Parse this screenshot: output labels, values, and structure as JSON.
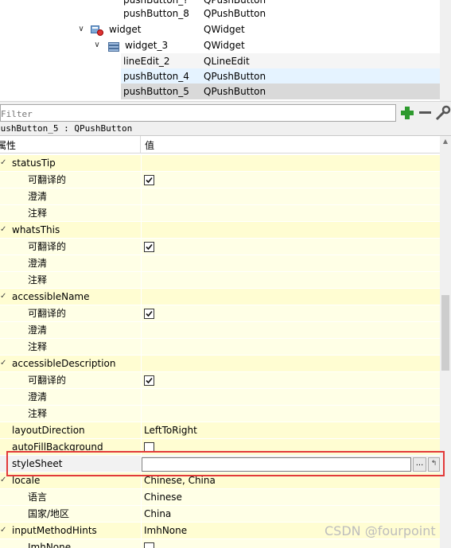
{
  "tree": {
    "rows": [
      {
        "name": "pushButton_?",
        "class": "QPushButton"
      },
      {
        "name": "pushButton_8",
        "class": "QPushButton"
      },
      {
        "name": "widget",
        "class": "QWidget"
      },
      {
        "name": "widget_3",
        "class": "QWidget"
      },
      {
        "name": "lineEdit_2",
        "class": "QLineEdit"
      },
      {
        "name": "pushButton_4",
        "class": "QPushButton"
      },
      {
        "name": "pushButton_5",
        "class": "QPushButton"
      }
    ],
    "icons": [
      "widget-form-icon",
      "layout-icon"
    ]
  },
  "filter": {
    "placeholder": "Filter"
  },
  "toolbar": {
    "icons": [
      "plus-icon",
      "minus-icon",
      "wrench-icon"
    ]
  },
  "object_title": "pushButton_5 : QPushButton",
  "grid": {
    "headers": {
      "property": "属性",
      "value": "值"
    },
    "rows": [
      {
        "name": "statusTip",
        "level": 0,
        "value": ""
      },
      {
        "name": "可翻译的",
        "level": 1,
        "checkbox": true,
        "checked": true
      },
      {
        "name": "澄清",
        "level": 1,
        "value": ""
      },
      {
        "name": "注释",
        "level": 1,
        "value": ""
      },
      {
        "name": "whatsThis",
        "level": 0,
        "value": ""
      },
      {
        "name": "可翻译的",
        "level": 1,
        "checkbox": true,
        "checked": true
      },
      {
        "name": "澄清",
        "level": 1,
        "value": ""
      },
      {
        "name": "注释",
        "level": 1,
        "value": ""
      },
      {
        "name": "accessibleName",
        "level": 0,
        "value": ""
      },
      {
        "name": "可翻译的",
        "level": 1,
        "checkbox": true,
        "checked": true
      },
      {
        "name": "澄清",
        "level": 1,
        "value": ""
      },
      {
        "name": "注释",
        "level": 1,
        "value": ""
      },
      {
        "name": "accessibleDescription",
        "level": 0,
        "value": ""
      },
      {
        "name": "可翻译的",
        "level": 1,
        "checkbox": true,
        "checked": true
      },
      {
        "name": "澄清",
        "level": 1,
        "value": ""
      },
      {
        "name": "注释",
        "level": 1,
        "value": ""
      },
      {
        "name": "layoutDirection",
        "level": 0,
        "value": "LeftToRight"
      },
      {
        "name": "autoFillBackground",
        "level": 0,
        "checkbox": true,
        "checked": false
      },
      {
        "name": "styleSheet",
        "level": 0,
        "value": "",
        "editor": true
      },
      {
        "name": "locale",
        "level": 0,
        "value": "Chinese, China"
      },
      {
        "name": "语言",
        "level": 1,
        "value": "Chinese"
      },
      {
        "name": "国家/地区",
        "level": 1,
        "value": "China"
      },
      {
        "name": "inputMethodHints",
        "level": 0,
        "value": "ImhNone"
      },
      {
        "name": "ImhNone",
        "level": 1,
        "checkbox": true,
        "checked": false
      }
    ],
    "stylesheet_more_label": "...",
    "stylesheet_reset_label": "↰"
  },
  "watermark": "CSDN @fourpoint",
  "colors": {
    "group_row": "#fffdd2",
    "child_row": "#ffffe6",
    "highlight": "#e23a3a",
    "selected_tree": "#cce8ff"
  }
}
